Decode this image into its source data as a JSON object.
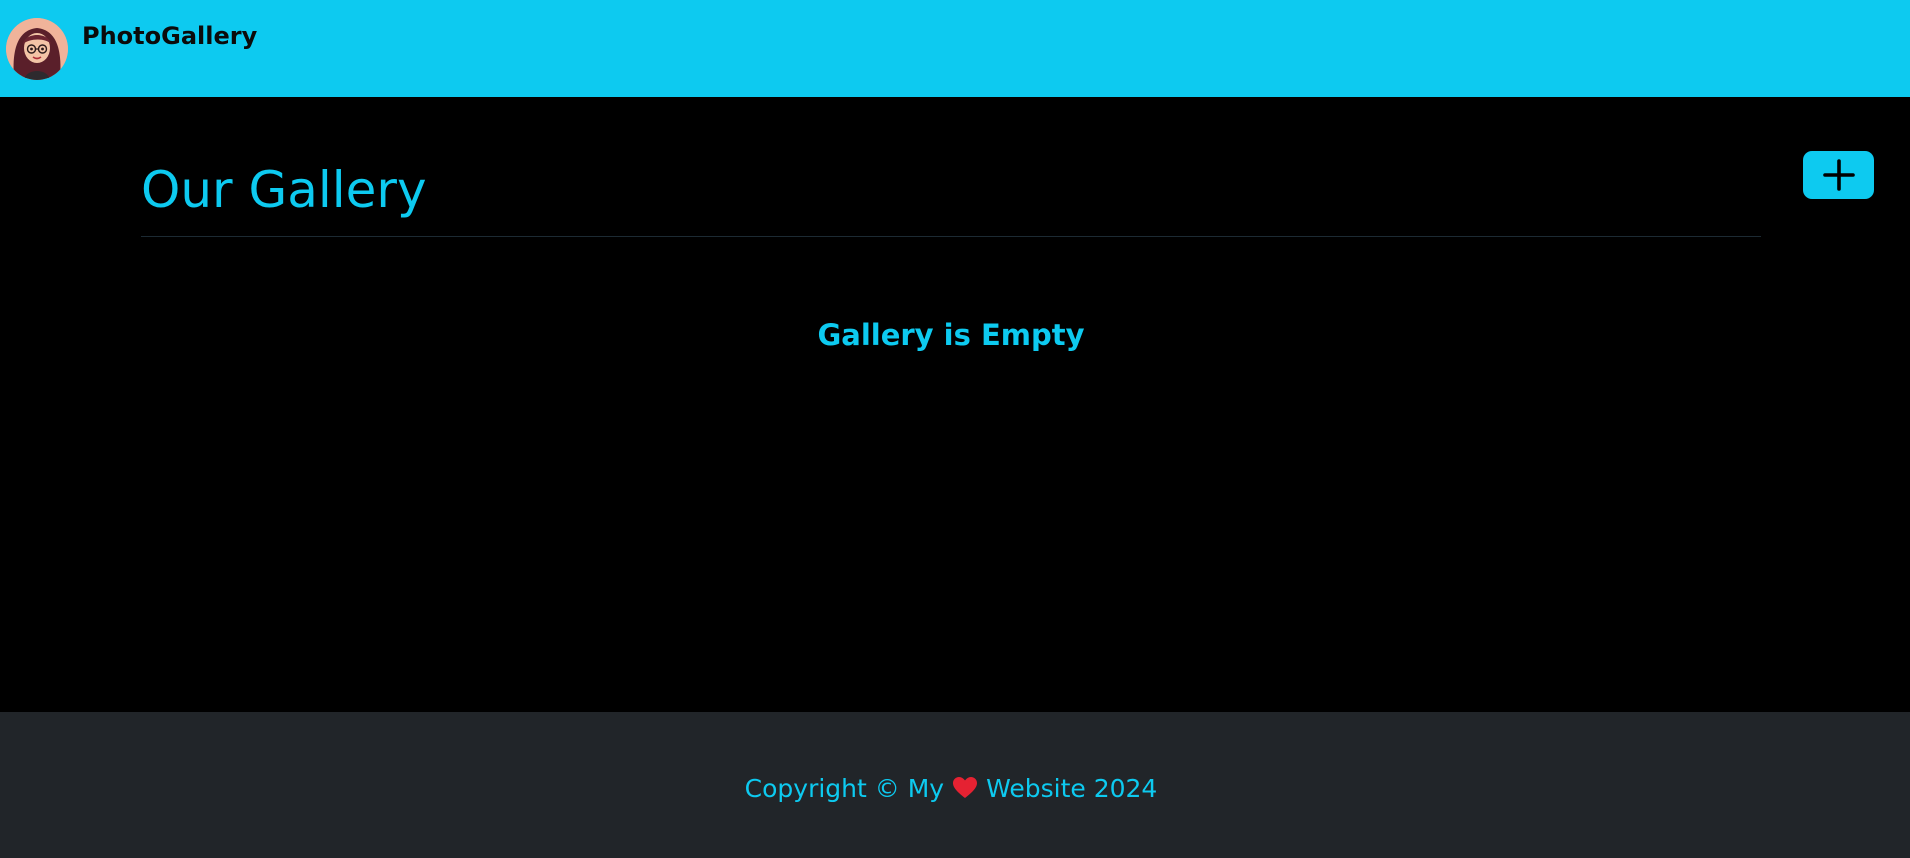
{
  "navbar": {
    "brand": "PhotoGallery",
    "avatar_icon": "avatar-cartoon-woman",
    "background_color": "#0dcaf0"
  },
  "main": {
    "title": "Our Gallery",
    "add_button_icon": "plus-icon",
    "empty_message": "Gallery is Empty",
    "background_color": "#000000",
    "accent_color": "#0dcaf0"
  },
  "footer": {
    "text_before": "Copyright © My",
    "heart_icon": "heart-icon",
    "heart_color": "#e52232",
    "text_after": "Website 2024",
    "background_color": "#212529"
  }
}
